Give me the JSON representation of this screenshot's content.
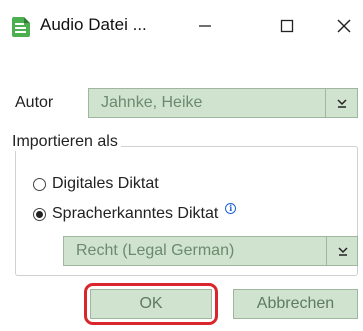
{
  "window": {
    "title": "Audio Datei ...",
    "app_icon": "document-icon",
    "controls": {
      "minimize_icon": "minimize-icon",
      "maximize_icon": "maximize-icon",
      "close_icon": "close-icon"
    }
  },
  "author": {
    "label": "Autor",
    "value": "Jahnke, Heike",
    "dropdown_icon": "chevron-down-icon"
  },
  "import_group": {
    "title": "Importieren als",
    "options": [
      {
        "label": "Digitales Diktat",
        "selected": false
      },
      {
        "label": "Spracherkanntes Diktat",
        "selected": true,
        "info_icon": "info-icon"
      }
    ],
    "language_select": {
      "value": "Recht (Legal German)",
      "dropdown_icon": "chevron-down-icon"
    }
  },
  "buttons": {
    "ok": "OK",
    "cancel": "Abbrechen"
  },
  "colors": {
    "accent_green": "#cfe3cf",
    "border_green": "#9fb79f",
    "highlight_red": "#d9262c",
    "icon_green": "#4caf50",
    "info_blue": "#1e63d6"
  }
}
